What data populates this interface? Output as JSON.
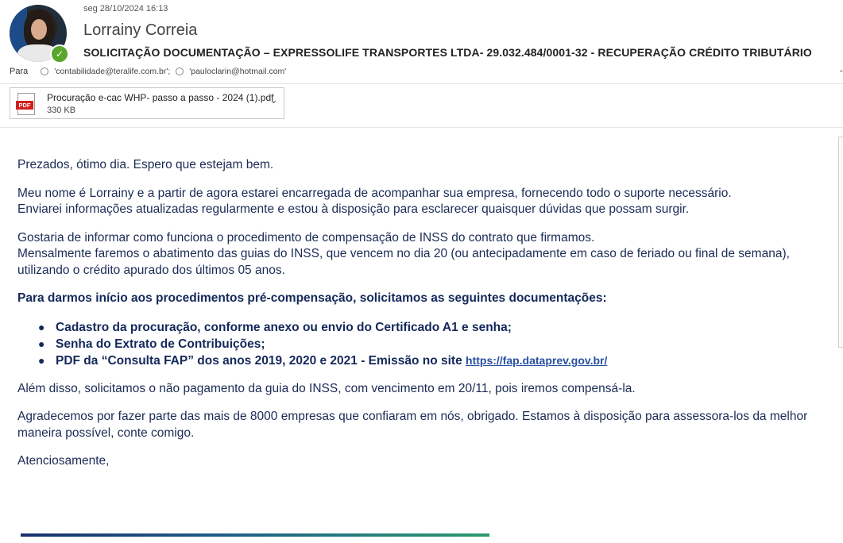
{
  "header": {
    "date": "seg 28/10/2024 16:13",
    "sender": "Lorrainy Correia",
    "subject": "SOLICITAÇÃO DOCUMENTAÇÃO – EXPRESSOLIFE TRANSPORTES LTDA- 29.032.484/0001-32 - RECUPERAÇÃO CRÉDITO TRIBUTÁRIO",
    "presence_color": "#5aa52c"
  },
  "recipients": {
    "label": "Para",
    "items": [
      "'contabilidade@teralife.com.br';",
      "'pauloclarin@hotmail.com'"
    ]
  },
  "attachment": {
    "icon_text": "PDF",
    "name": "Procuração e-cac WHP- passo a passo - 2024 (1).pdf",
    "size": "330 KB"
  },
  "body": {
    "p1": "Prezados, ótimo dia. Espero que estejam bem.",
    "p2a": "Meu nome é Lorrainy e a partir de agora estarei encarregada de acompanhar sua empresa, fornecendo todo o suporte necessário.",
    "p2b": "Enviarei informações atualizadas regularmente e estou à disposição para esclarecer quaisquer dúvidas que possam surgir.",
    "p3a": "Gostaria de informar como funciona o procedimento de compensação de INSS do contrato que firmamos.",
    "p3b": "Mensalmente faremos o abatimento das guias do INSS, que vencem no dia 20 (ou antecipadamente em caso de feriado ou final de semana), utilizando o crédito apurado dos últimos 05 anos.",
    "p4": "Para darmos início aos procedimentos pré-compensação, solicitamos as seguintes documentações:",
    "list": [
      "Cadastro da procuração, conforme anexo ou envio do Certificado A1  e senha;",
      "Senha do Extrato de Contribuições;",
      "PDF da “Consulta FAP” dos anos 2019, 2020 e 2021 - Emissão no site"
    ],
    "link": "https://fap.dataprev.gov.br/",
    "p5": "Além disso, solicitamos o não pagamento da guia do INSS, com vencimento em 20/11, pois iremos compensá-la.",
    "p6": "Agradecemos por fazer parte das mais de 8000 empresas que confiaram em nós, obrigado. Estamos à disposição para assessora-los da melhor maneira possível, conte comigo.",
    "p7": "Atenciosamente,"
  }
}
